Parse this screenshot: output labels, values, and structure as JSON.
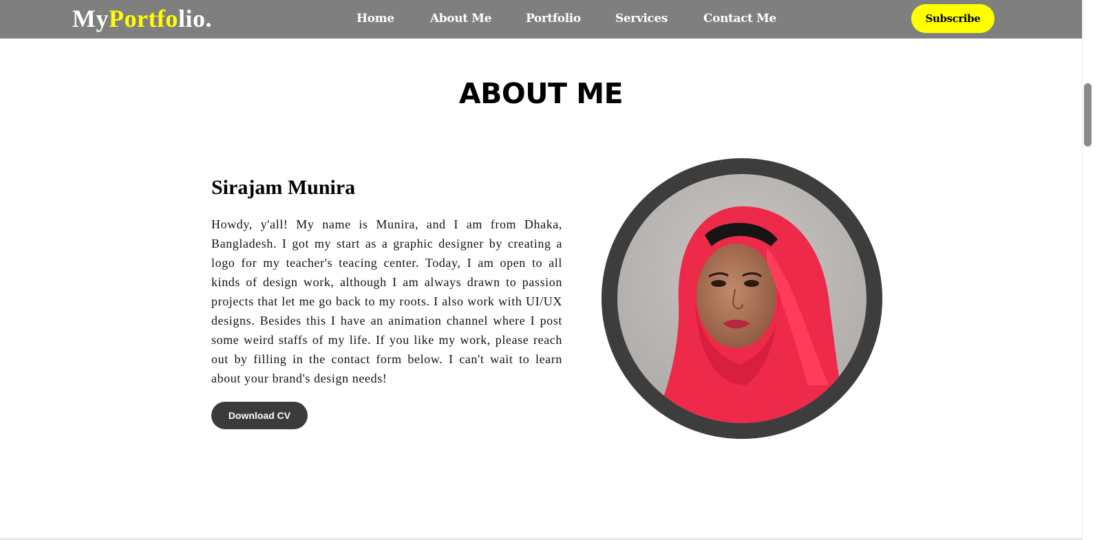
{
  "nav": {
    "logo": {
      "part1": "My",
      "part2": "Portfo",
      "part3": "lio."
    },
    "links": [
      "Home",
      "About Me",
      "Portfolio",
      "Services",
      "Contact Me"
    ],
    "subscribe_label": "Subscribe"
  },
  "about": {
    "title": "ABOUT ME",
    "name": "Sirajam Munira",
    "bio": "Howdy, y'all! My name is Munira, and I am from Dhaka, Bangladesh. I got my start as a graphic designer by creating a logo for my teacher's teacing center. Today, I am open to all kinds of design work, although I am always drawn to passion projects that let me go back to my roots. I also work with UI/UX designs. Besides this I have an animation channel where I post some weird staffs of my life. If you like my work, please reach out by filling in the contact form below. I can't wait to learn about your brand's design needs!",
    "download_label": "Download CV"
  },
  "colors": {
    "navbar_bg": "#7f7f7f",
    "accent": "#ffff00",
    "button_dark": "#3b3b3b",
    "avatar_ring": "#3d3d3d"
  }
}
